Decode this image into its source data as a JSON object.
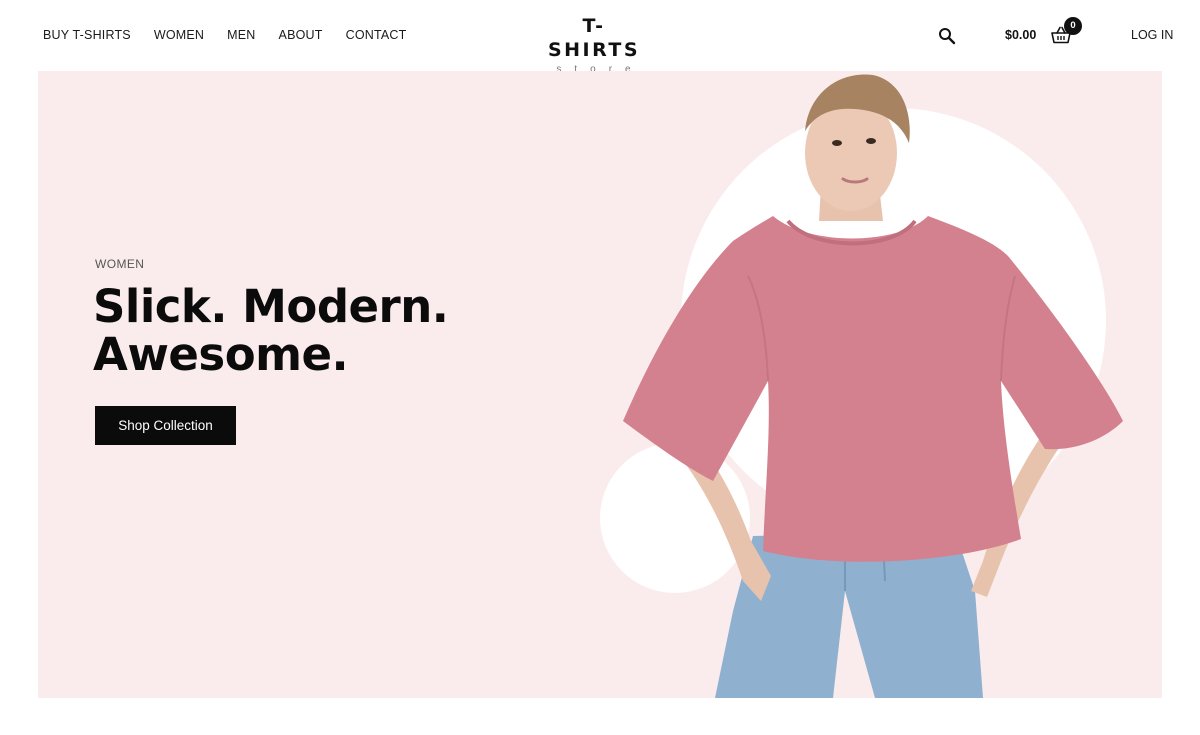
{
  "nav": {
    "items": [
      {
        "label": "BUY T-SHIRTS"
      },
      {
        "label": "WOMEN"
      },
      {
        "label": "MEN"
      },
      {
        "label": "ABOUT"
      },
      {
        "label": "CONTACT"
      }
    ]
  },
  "logo": {
    "title": "T-SHIRTS",
    "subtitle": "store"
  },
  "header": {
    "cart_total": "$0.00",
    "cart_count": "0",
    "login_label": "LOG IN"
  },
  "hero": {
    "eyebrow": "WOMEN",
    "headline_line1": "Slick. Modern.",
    "headline_line2": "Awesome.",
    "cta_label": "Shop Collection",
    "image": "woman-in-pink-oversized-tshirt"
  },
  "icons": {
    "search": "search-icon",
    "cart": "basket-icon"
  },
  "colors": {
    "hero_bg": "#faecec",
    "shirt": "#d4818f",
    "jeans": "#8fb1cf",
    "button_bg": "#0b0b0b"
  }
}
